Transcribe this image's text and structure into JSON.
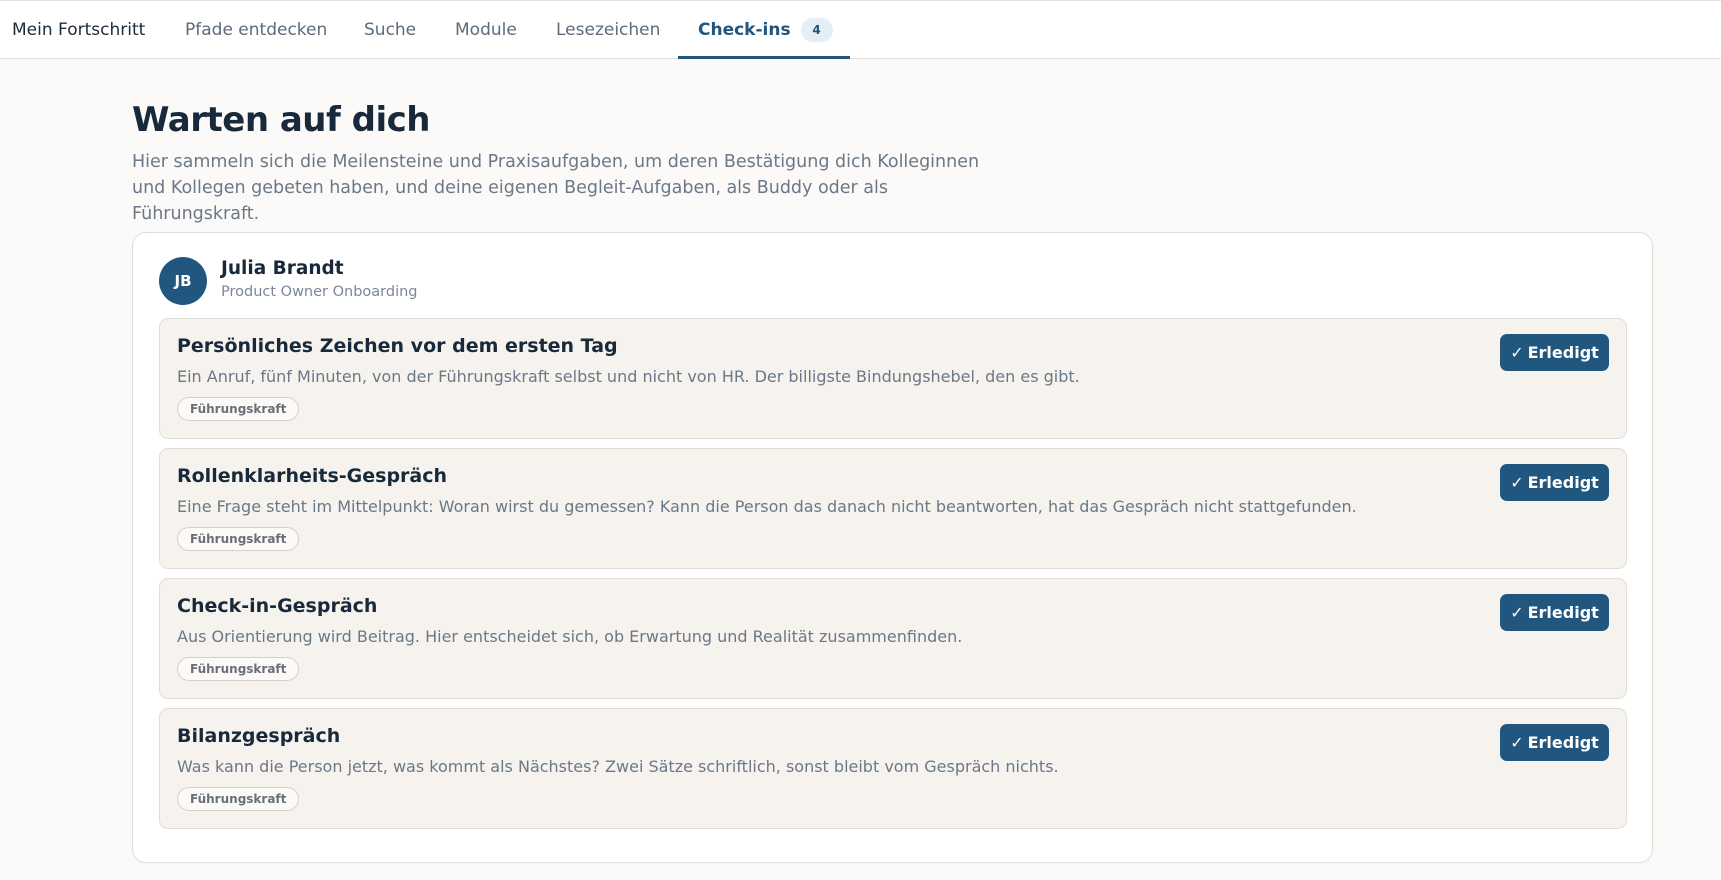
{
  "nav": {
    "tabs": [
      {
        "label": "Mein Fortschritt"
      },
      {
        "label": "Pfade entdecken"
      },
      {
        "label": "Suche"
      },
      {
        "label": "Module"
      },
      {
        "label": "Lesezeichen"
      },
      {
        "label": "Check-ins",
        "badge": "4",
        "active": true
      }
    ]
  },
  "header": {
    "title": "Warten auf dich",
    "description": "Hier sammeln sich die Meilensteine und Praxisaufgaben, um deren Bestätigung dich Kolleginnen und Kollegen gebeten haben, und deine eigenen Begleit-Aufgaben, als Buddy oder als Führungskraft."
  },
  "person": {
    "initials": "JB",
    "name": "Julia Brandt",
    "program": "Product Owner Onboarding",
    "tasks": [
      {
        "title": "Persönliches Zeichen vor dem ersten Tag",
        "description": "Ein Anruf, fünf Minuten, von der Führungskraft selbst und nicht von HR. Der billigste Bindungshebel, den es gibt.",
        "tag": "Führungskraft",
        "button_label": "Erledigt"
      },
      {
        "title": "Rollenklarheits-Gespräch",
        "description": "Eine Frage steht im Mittelpunkt: Woran wirst du gemessen? Kann die Person das danach nicht beantworten, hat das Gespräch nicht stattgefunden.",
        "tag": "Führungskraft",
        "button_label": "Erledigt"
      },
      {
        "title": "Check-in-Gespräch",
        "description": "Aus Orientierung wird Beitrag. Hier entscheidet sich, ob Erwartung und Realität zusammenfinden.",
        "tag": "Führungskraft",
        "button_label": "Erledigt"
      },
      {
        "title": "Bilanzgespräch",
        "description": "Was kann die Person jetzt, was kommt als Nächstes? Zwei Sätze schriftlich, sonst bleibt vom Gespräch nichts.",
        "tag": "Führungskraft",
        "button_label": "Erledigt"
      }
    ]
  },
  "icons": {
    "done_button_icon": "check-icon",
    "check_glyph": "✓"
  },
  "colors": {
    "accent": "#21577f",
    "task_background": "#f6f3ee",
    "page_background": "#fbfaf8"
  }
}
